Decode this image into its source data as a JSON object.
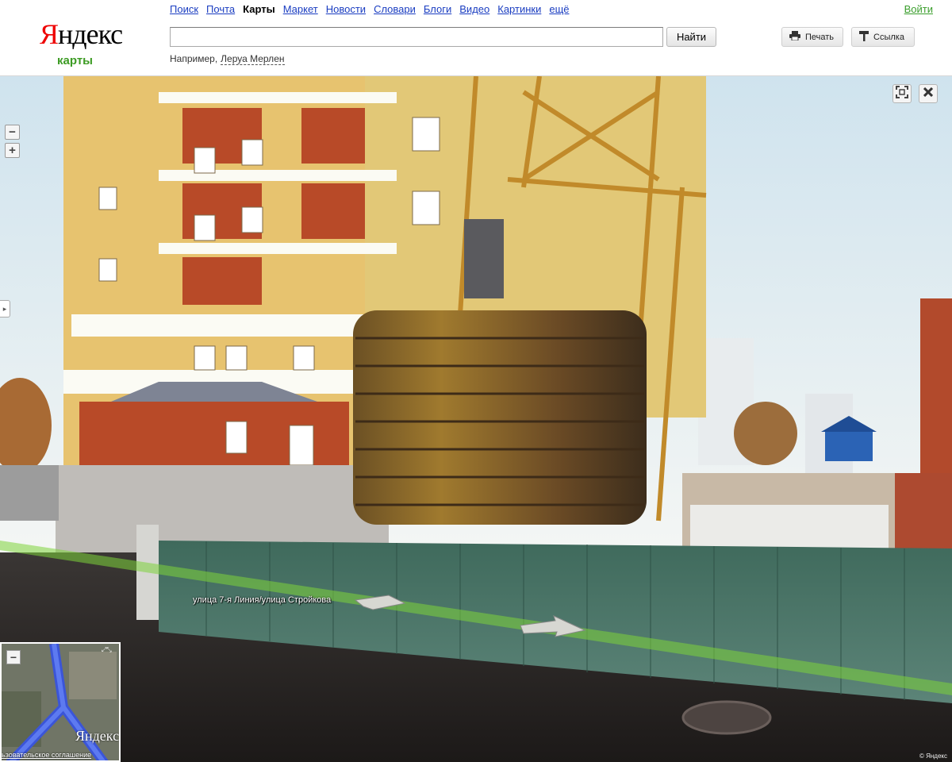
{
  "header": {
    "logo_text": "Яндекс",
    "logo_first": "Я",
    "logo_rest": "ндекс",
    "logo_sub": "карты",
    "nav": [
      "Поиск",
      "Почта",
      "Карты",
      "Маркет",
      "Новости",
      "Словари",
      "Блоги",
      "Видео",
      "Картинки",
      "ещё"
    ],
    "nav_current": "Карты",
    "login": "Войти",
    "search": {
      "value": "",
      "button": "Найти"
    },
    "example_prefix": "Например,",
    "example_link": "Леруа Мерлен",
    "print_label": "Печать",
    "link_label": "Ссылка"
  },
  "panorama": {
    "zoom_out": "−",
    "zoom_in": "+",
    "side_toggle": "▸",
    "street_label": "улица 7-я Линия/улица Стройкова",
    "copyright": "© Яндекс"
  },
  "minimap": {
    "zoom_out": "−",
    "logo": "Яндекс",
    "terms": "ьзовательское соглашение"
  },
  "icons": {
    "fullscreen": "fullscreen-icon",
    "close": "close-icon",
    "print": "printer-icon",
    "link": "link-icon"
  },
  "colors": {
    "logo_red": "#ee0000",
    "link_blue": "#1a3dc1",
    "logo_sub_green": "#3c9b23",
    "route_line": "#7ed43a"
  }
}
